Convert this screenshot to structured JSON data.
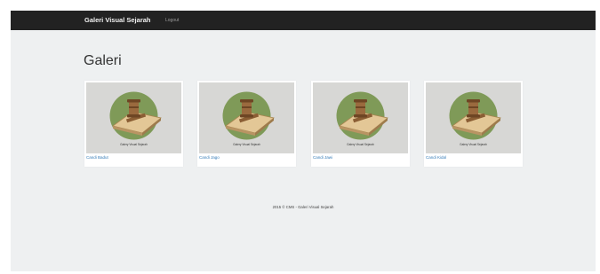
{
  "navbar": {
    "brand": "Galeri Visual Sejarah",
    "logout_label": "Logout"
  },
  "main": {
    "title": "Galeri",
    "gallery": [
      {
        "title": "Candi Badut",
        "image_caption": "Galery Visual Sejarah"
      },
      {
        "title": "Candi Jago",
        "image_caption": "Galery Visual Sejarah"
      },
      {
        "title": "Candi Jawi",
        "image_caption": "Galery Visual Sejarah"
      },
      {
        "title": "Candi Kidal",
        "image_caption": "Galery Visual Sejarah"
      }
    ]
  },
  "footer": {
    "text": "2015 © CMS - Galeri Visual Sejarah"
  },
  "colors": {
    "navbar_bg": "#222222",
    "page_bg": "#eef0f1",
    "link": "#337ab7",
    "logo_circle": "#7f9a58"
  },
  "icons": {
    "logo": "gavel-on-book-logo"
  }
}
